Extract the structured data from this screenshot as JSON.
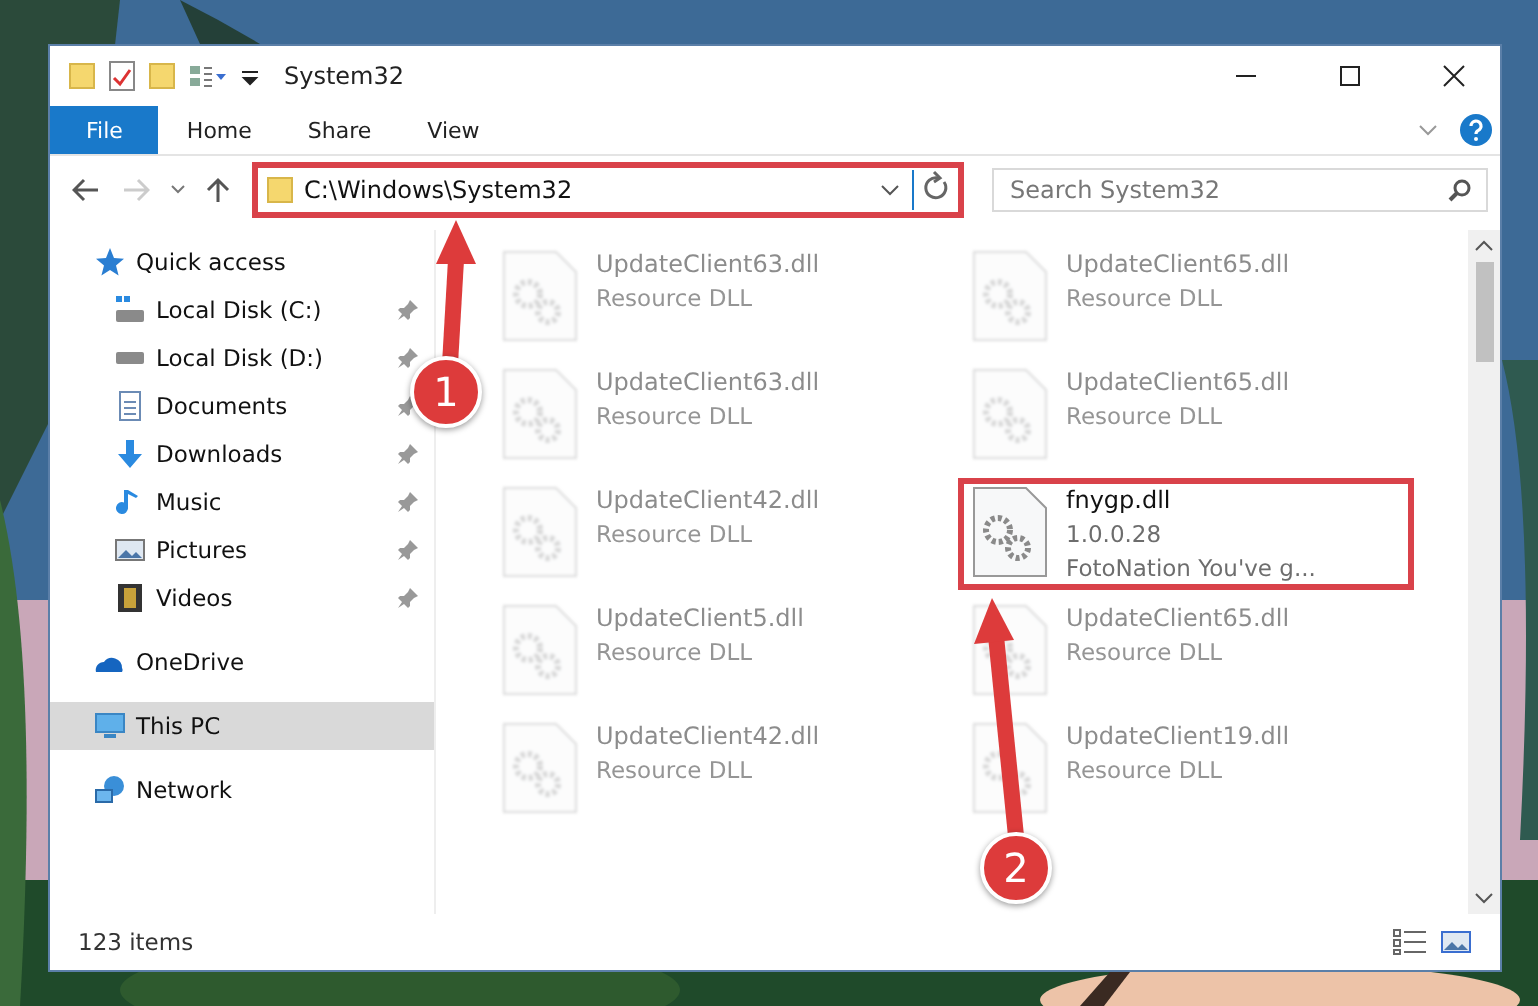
{
  "window": {
    "title": "System32"
  },
  "ribbon_tabs": [
    {
      "label": "File",
      "selected": true
    },
    {
      "label": "Home",
      "selected": false
    },
    {
      "label": "Share",
      "selected": false
    },
    {
      "label": "View",
      "selected": false
    }
  ],
  "address": {
    "value": "C:\\Windows\\System32"
  },
  "search": {
    "placeholder": "Search System32"
  },
  "sidebar": [
    {
      "label": "Quick access",
      "kind": "star",
      "selected": false,
      "children": [
        {
          "label": "Local Disk (C:)",
          "kind": "drive-c",
          "pinned": true
        },
        {
          "label": "Local Disk (D:)",
          "kind": "drive",
          "pinned": true
        },
        {
          "label": "Documents",
          "kind": "document",
          "pinned": true
        },
        {
          "label": "Downloads",
          "kind": "download",
          "pinned": true
        },
        {
          "label": "Music",
          "kind": "music",
          "pinned": true
        },
        {
          "label": "Pictures",
          "kind": "pictures",
          "pinned": true
        },
        {
          "label": "Videos",
          "kind": "video",
          "pinned": true
        }
      ]
    },
    {
      "label": "OneDrive",
      "kind": "cloud",
      "selected": false
    },
    {
      "label": "This PC",
      "kind": "pc",
      "selected": true
    },
    {
      "label": "Network",
      "kind": "network",
      "selected": false
    }
  ],
  "files": [
    {
      "name": "UpdateClient63.dll",
      "details": [
        "Resource DLL"
      ],
      "kind": "blurred"
    },
    {
      "name": "UpdateClient65.dll",
      "details": [
        "Resource DLL"
      ],
      "kind": "blurred"
    },
    {
      "name": "UpdateClient63.dll",
      "details": [
        "Resource DLL"
      ],
      "kind": "blurred"
    },
    {
      "name": "UpdateClient65.dll",
      "details": [
        "Resource DLL"
      ],
      "kind": "blurred"
    },
    {
      "name": "UpdateClient42.dll",
      "details": [
        "Resource DLL"
      ],
      "kind": "blurred"
    },
    {
      "name": "fnygp.dll",
      "details": [
        "1.0.0.28",
        "FotoNation You've g..."
      ],
      "kind": "clear"
    },
    {
      "name": "UpdateClient5.dll",
      "details": [
        "Resource DLL"
      ],
      "kind": "blurred"
    },
    {
      "name": "UpdateClient65.dll",
      "details": [
        "Resource DLL"
      ],
      "kind": "blurred"
    },
    {
      "name": "UpdateClient42.dll",
      "details": [
        "Resource DLL"
      ],
      "kind": "blurred"
    },
    {
      "name": "UpdateClient19.dll",
      "details": [
        "Resource DLL"
      ],
      "kind": "blurred"
    }
  ],
  "status_bar": {
    "item_count": "123 items"
  },
  "callouts": [
    {
      "number": "1"
    },
    {
      "number": "2"
    }
  ]
}
